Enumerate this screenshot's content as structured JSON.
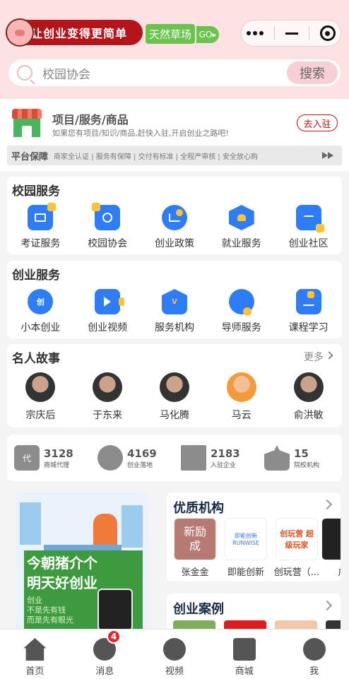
{
  "header": {
    "slogan": "让创业变得更简单",
    "grass_label": "天然草场",
    "go_label": "GO▸"
  },
  "search": {
    "placeholder": "校园协会",
    "button": "搜索"
  },
  "merchant": {
    "title": "项目/服务/商品",
    "subtitle": "如果您有项目/知识/商品,赶快入驻,开启创业之路吧!",
    "enter_button": "去入驻",
    "guarantee_title": "平台保障",
    "guarantee_items": "商家全认证 | 服务有保障 | 交付有标准 | 全程严审核 | 安全放心购"
  },
  "campus_services": {
    "title": "校园服务",
    "items": [
      {
        "label": "考证服务",
        "icon": "calendar-icon"
      },
      {
        "label": "校园协会",
        "icon": "star-badge-icon"
      },
      {
        "label": "创业政策",
        "icon": "trend-chart-icon"
      },
      {
        "label": "就业服务",
        "icon": "hand-heart-icon"
      },
      {
        "label": "创业社区",
        "icon": "chat-bubble-icon"
      }
    ]
  },
  "startup_services": {
    "title": "创业服务",
    "items": [
      {
        "label": "小本创业",
        "icon": "chuang-coin-icon"
      },
      {
        "label": "创业视频",
        "icon": "video-play-icon"
      },
      {
        "label": "服务机构",
        "icon": "institution-icon"
      },
      {
        "label": "导师服务",
        "icon": "graduation-cap-icon"
      },
      {
        "label": "课程学习",
        "icon": "course-chart-icon"
      }
    ]
  },
  "stories": {
    "title": "名人故事",
    "more": "更多",
    "people": [
      {
        "name": "宗庆后"
      },
      {
        "name": "于东来"
      },
      {
        "name": "马化腾"
      },
      {
        "name": "马云"
      },
      {
        "name": "俞洪敏"
      }
    ]
  },
  "stats": [
    {
      "num": "3128",
      "label": "商城代理",
      "icon_text": "代"
    },
    {
      "num": "4169",
      "label": "创业落地",
      "icon_text": ""
    },
    {
      "num": "2183",
      "label": "入驻企业",
      "icon_text": ""
    },
    {
      "num": "15",
      "label": "院校机构",
      "icon_text": ""
    }
  ],
  "promo": {
    "line1": "今朝猪介个",
    "line2": "明天好创业",
    "small": "创业\n不是先有钱\n而是先有眼光"
  },
  "quality_orgs": {
    "title": "优质机构",
    "items": [
      {
        "name": "张金金",
        "logo_text": "新励成"
      },
      {
        "name": "即能创新",
        "logo_text": "即能创新 RUNWISE"
      },
      {
        "name": "创玩营（...",
        "logo_text": "创玩营 超级玩家"
      },
      {
        "name": "广",
        "logo_text": ""
      }
    ]
  },
  "cases": {
    "title": "创业案例"
  },
  "tabbar": {
    "items": [
      {
        "label": "首页"
      },
      {
        "label": "消息"
      },
      {
        "label": "视频"
      },
      {
        "label": "商城"
      },
      {
        "label": "我"
      }
    ],
    "badge": "4"
  },
  "colors": {
    "brand_red": "#b3151b",
    "icon_blue": "#2e7cf6",
    "accent_yellow": "#ffc233",
    "header_pink": "#fde1e3"
  }
}
